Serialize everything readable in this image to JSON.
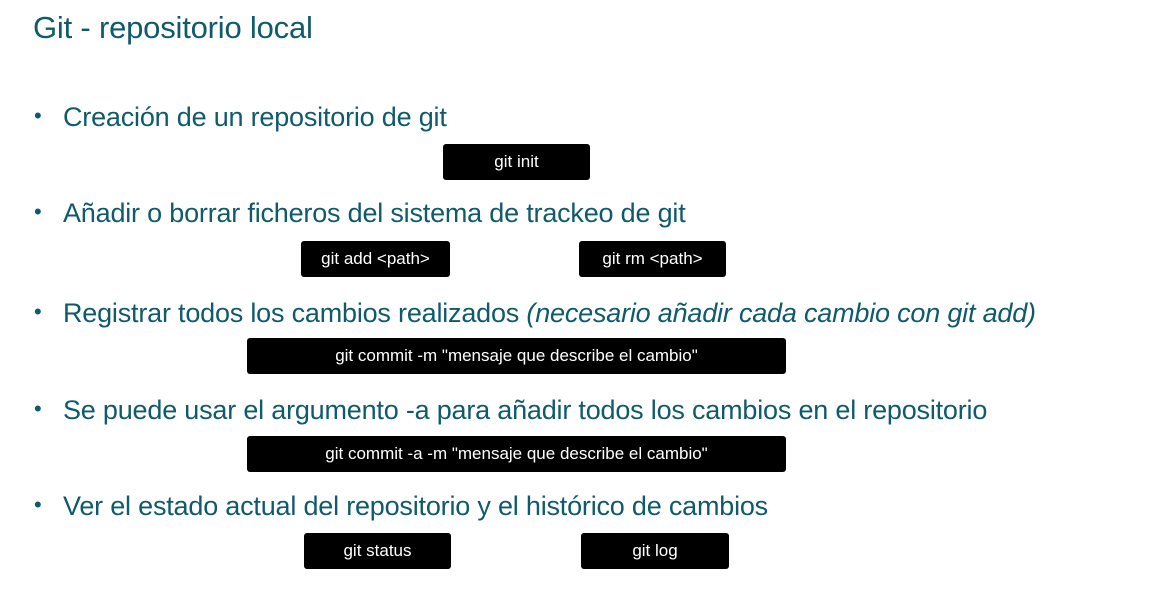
{
  "slide": {
    "title": "Git - repositorio local",
    "bullet_glyph": "•",
    "items": [
      {
        "text": "Creación de un repositorio de git",
        "note": "",
        "commands": [
          "git init"
        ]
      },
      {
        "text": "Añadir o borrar ficheros del sistema de trackeo de git",
        "note": "",
        "commands": [
          "git add <path>",
          "git rm <path>"
        ]
      },
      {
        "text": "Registrar todos los cambios realizados ",
        "note": "(necesario añadir cada cambio con git add)",
        "commands": [
          "git commit -m \"mensaje que describe el cambio\""
        ]
      },
      {
        "text": "Se puede usar el argumento -a para añadir todos los cambios en el repositorio",
        "note": "",
        "commands": [
          "git commit -a -m \"mensaje que describe el cambio\""
        ]
      },
      {
        "text": "Ver el estado actual del repositorio y el histórico de cambios",
        "note": "",
        "commands": [
          "git status",
          "git log"
        ]
      }
    ]
  }
}
